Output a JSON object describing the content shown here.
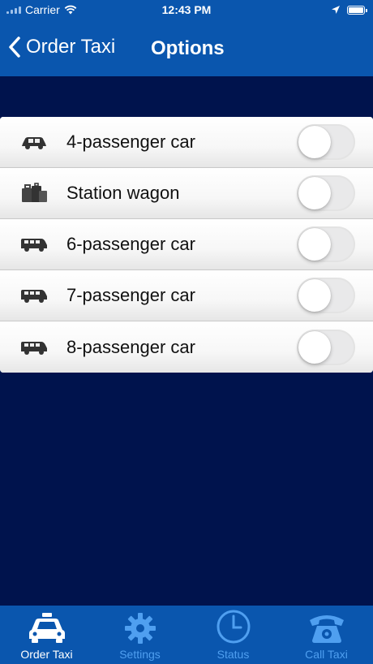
{
  "status_bar": {
    "carrier": "Carrier",
    "time": "12:43 PM"
  },
  "nav": {
    "back_label": "Order Taxi",
    "title": "Options"
  },
  "options": [
    {
      "label": "4-passenger car",
      "icon": "sedan-icon",
      "enabled": false
    },
    {
      "label": "Station wagon",
      "icon": "luggage-icon",
      "enabled": false
    },
    {
      "label": "6-passenger car",
      "icon": "van-icon",
      "enabled": false
    },
    {
      "label": "7-passenger car",
      "icon": "van-icon",
      "enabled": false
    },
    {
      "label": "8-passenger car",
      "icon": "van-icon",
      "enabled": false
    }
  ],
  "tabs": [
    {
      "label": "Order Taxi",
      "icon": "taxi-icon",
      "active": true
    },
    {
      "label": "Settings",
      "icon": "gear-icon",
      "active": false
    },
    {
      "label": "Status",
      "icon": "clock-icon",
      "active": false
    },
    {
      "label": "Call Taxi",
      "icon": "phone-icon",
      "active": false
    }
  ],
  "colors": {
    "bar_blue": "#0a56ae",
    "background_navy": "#00134d",
    "tab_inactive": "#4f9ff0",
    "toggle_off": "#e9e9ea"
  }
}
